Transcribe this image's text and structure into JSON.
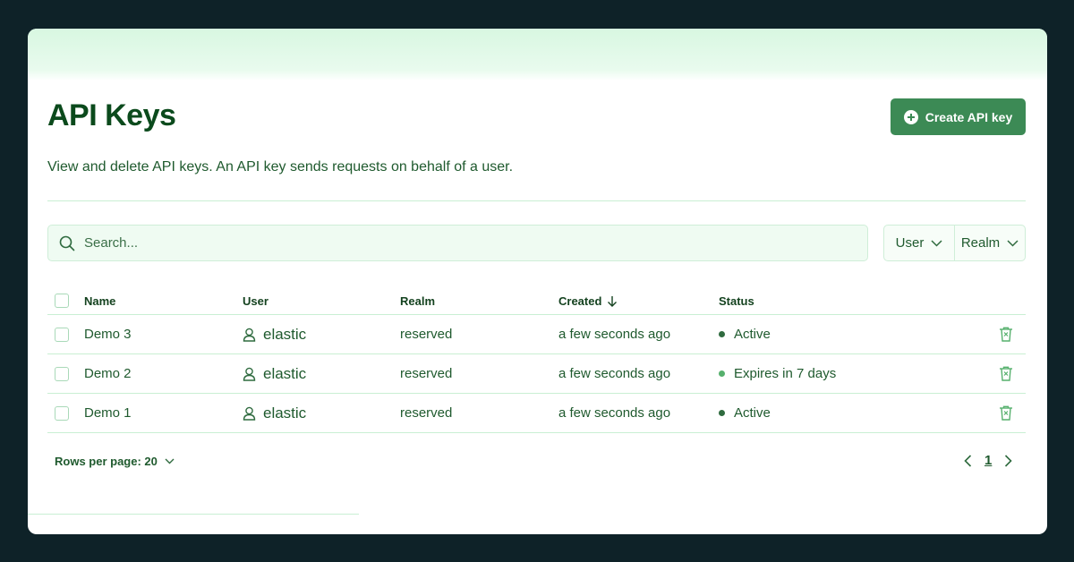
{
  "header": {
    "title": "API Keys",
    "create_button_label": "Create API key",
    "description": "View and delete API keys. An API key sends requests on behalf of a user."
  },
  "search": {
    "placeholder": "Search..."
  },
  "filters": [
    {
      "label": "User",
      "icon": "chevron-down-icon"
    },
    {
      "label": "Realm",
      "icon": "chevron-down-icon"
    }
  ],
  "table": {
    "columns": {
      "name": "Name",
      "user": "User",
      "realm": "Realm",
      "created": "Created",
      "status": "Status"
    },
    "created_sort_icon": "arrow-down-icon",
    "rows": [
      {
        "name": "Demo 3",
        "user": "elastic",
        "realm": "reserved",
        "created": "a few seconds ago",
        "status": "Active",
        "status_color": "#2f6b3f"
      },
      {
        "name": "Demo 2",
        "user": "elastic",
        "realm": "reserved",
        "created": "a few seconds ago",
        "status": "Expires in 7 days",
        "status_color": "#56b06d"
      },
      {
        "name": "Demo 1",
        "user": "elastic",
        "realm": "reserved",
        "created": "a few seconds ago",
        "status": "Active",
        "status_color": "#2f6b3f"
      }
    ]
  },
  "pagination": {
    "rows_per_page_label": "Rows per page: 20",
    "current_page": "1"
  },
  "colors": {
    "background": "#0e2228",
    "accent": "#3c8a55",
    "text": "#1f5a2e",
    "border": "#c9efd3"
  }
}
